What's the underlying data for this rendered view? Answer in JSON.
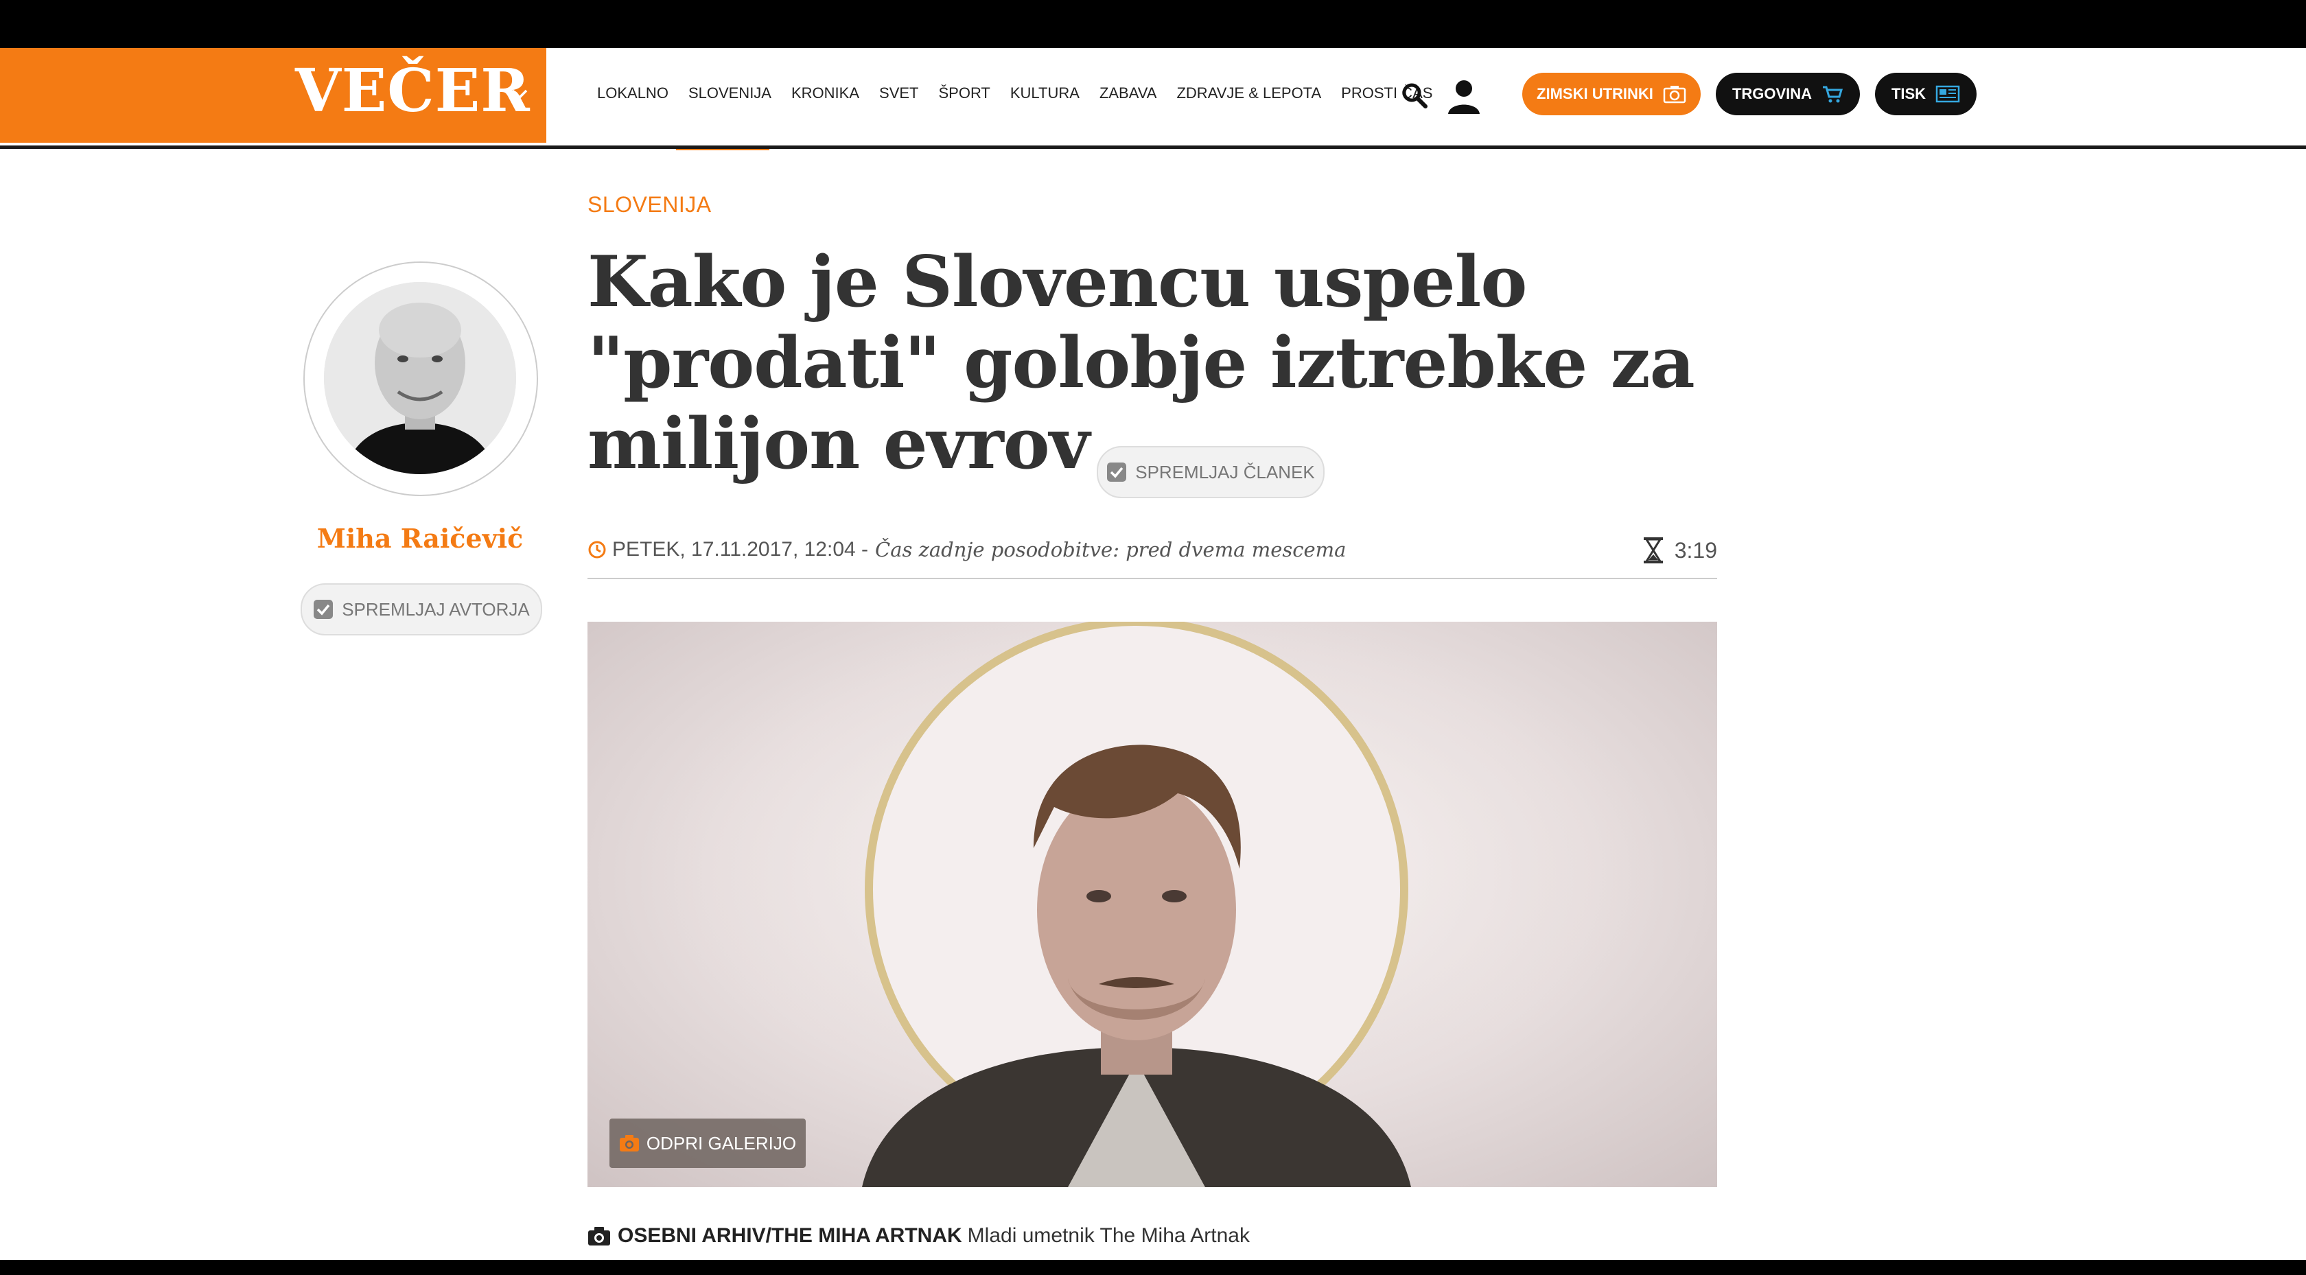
{
  "header": {
    "logo": "VEČER",
    "nav": [
      {
        "label": "LOKALNO"
      },
      {
        "label": "SLOVENIJA"
      },
      {
        "label": "KRONIKA"
      },
      {
        "label": "SVET"
      },
      {
        "label": "ŠPORT"
      },
      {
        "label": "KULTURA"
      },
      {
        "label": "ZABAVA"
      },
      {
        "label": "ZDRAVJE & LEPOTA"
      },
      {
        "label": "PROSTI ČAS"
      }
    ],
    "active_nav": "SLOVENIJA",
    "buttons": {
      "zimski": "ZIMSKI UTRINKI",
      "trgovina": "TRGOVINA",
      "tisk": "TISK"
    },
    "accent_color": "#f47b14"
  },
  "article": {
    "section": "SLOVENIJA",
    "title": "Kako je Slovencu uspelo \"prodati\" golobje iztrebke za milijon evrov",
    "follow_article_label": "SPREMLJAJ ČLANEK",
    "date": "PETEK, 17.11.2017, 12:04 -",
    "updated": "Čas zadnje posodobitve: pred dvema mescema",
    "reading_time": "3:19",
    "gallery_label": "ODPRI GALERIJO",
    "caption_credit": "OSEBNI ARHIV/THE MIHA ARTNAK",
    "caption_text": "Mladi umetnik The Miha Artnak"
  },
  "author": {
    "name": "Miha Raičevič",
    "follow_label": "SPREMLJAJ AVTORJA"
  }
}
